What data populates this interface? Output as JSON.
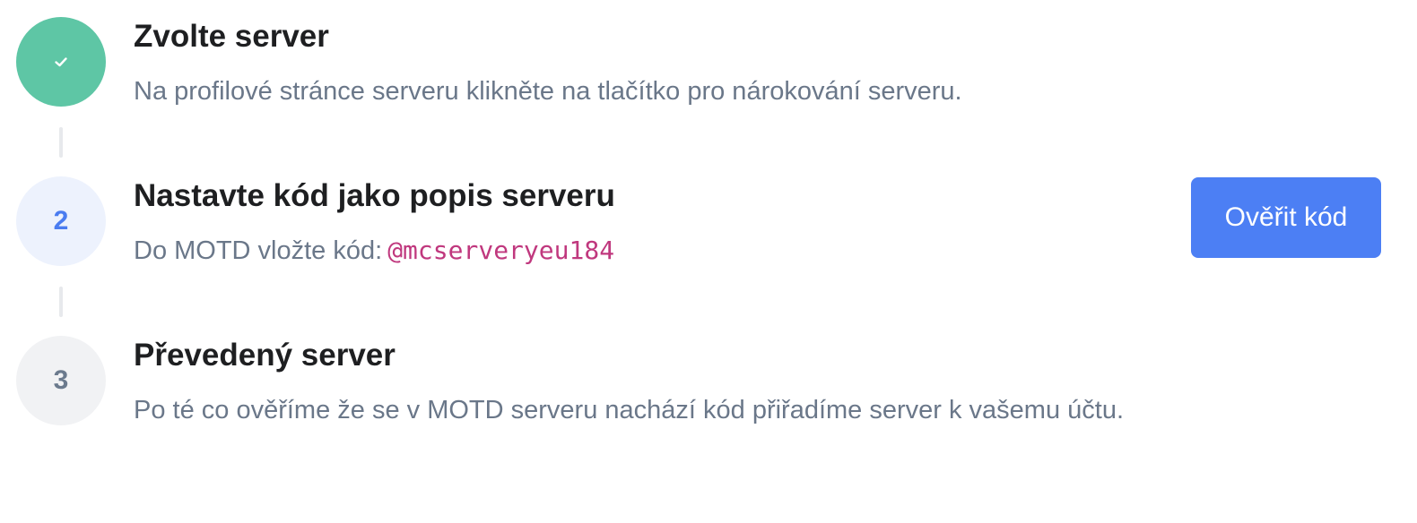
{
  "accent_color": "#4c7ff4",
  "done_color": "#5ec6a5",
  "steps": [
    {
      "status": "done",
      "icon": "check-icon",
      "title": "Zvolte server",
      "description": "Na profilové stránce serveru klikněte na tlačítko pro nárokování serveru."
    },
    {
      "status": "active",
      "number": "2",
      "title": "Nastavte kód jako popis serveru",
      "description": "Do MOTD vložte kód:",
      "code": "@mcserveryeu184",
      "button_label": "Ověřit kód"
    },
    {
      "status": "pending",
      "number": "3",
      "title": "Převedený server",
      "description": "Po té co ověříme že se v MOTD serveru nachází kód přiřadíme server k vašemu účtu."
    }
  ]
}
